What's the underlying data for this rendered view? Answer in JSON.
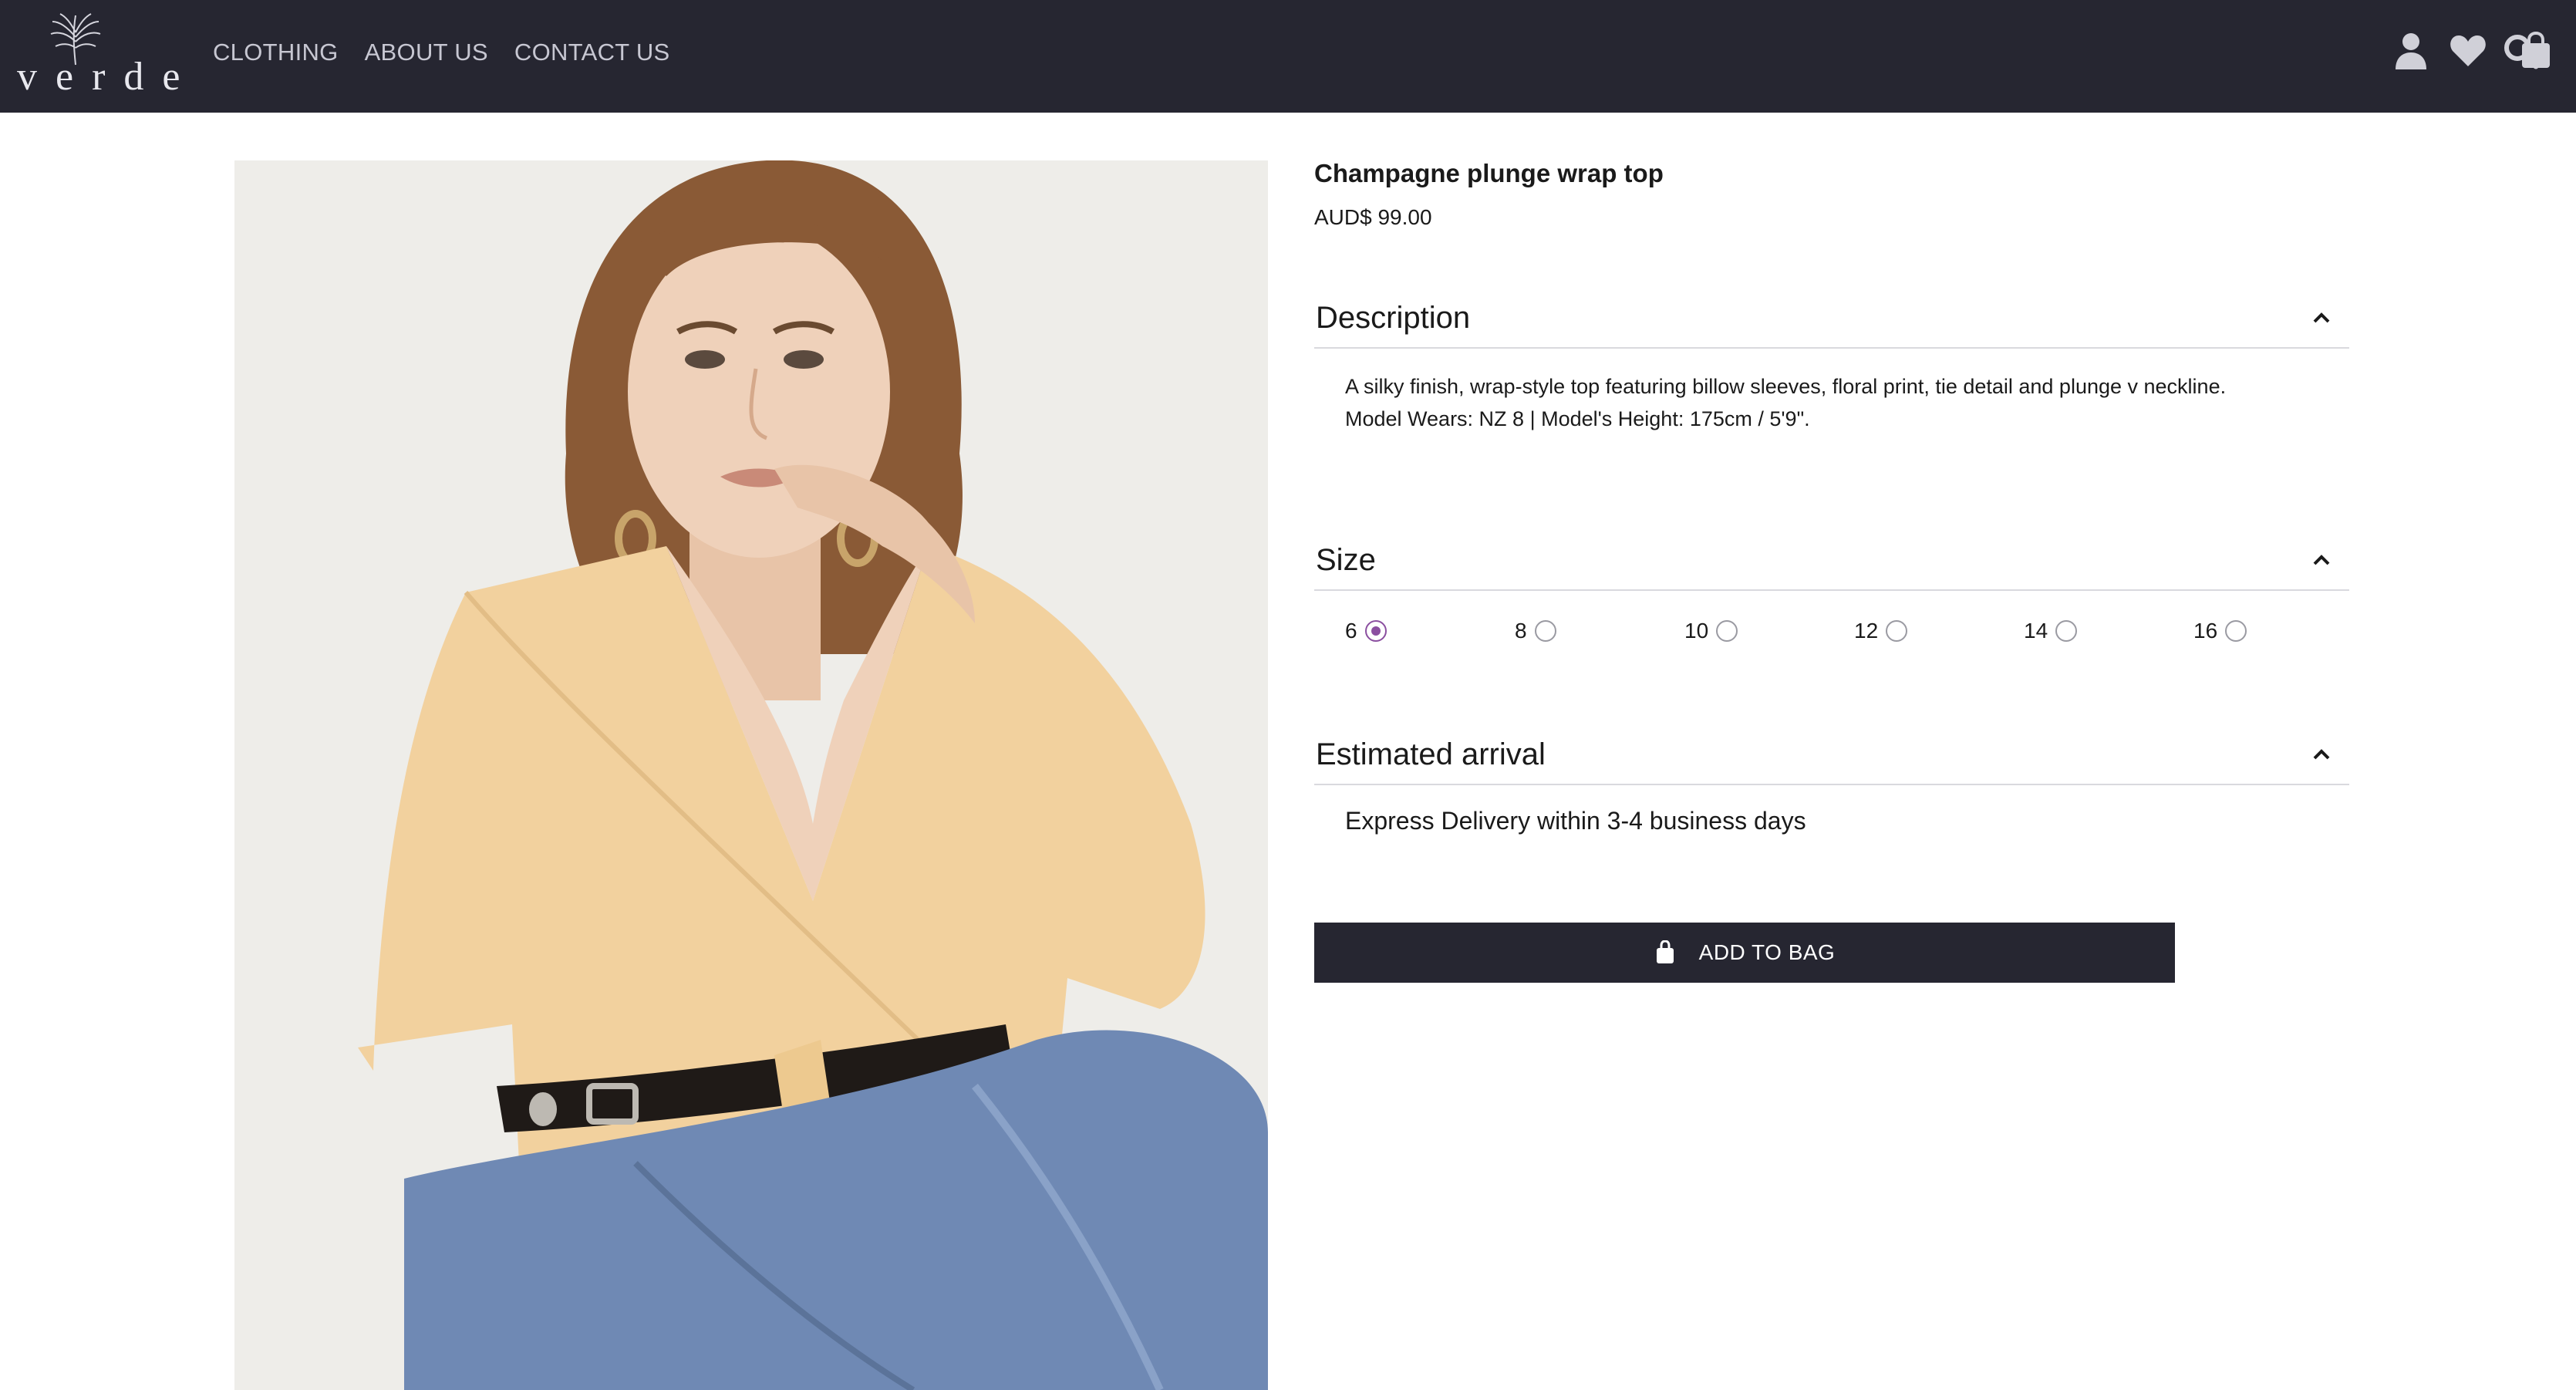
{
  "header": {
    "logo_text": "verde",
    "nav": [
      "CLOTHING",
      "ABOUT US",
      "CONTACT US"
    ],
    "icons": [
      "search-icon",
      "user-icon",
      "heart-icon",
      "bag-icon"
    ]
  },
  "product": {
    "title": "Champagne plunge wrap top",
    "price": "AUD$ 99.00",
    "description": {
      "heading": "Description",
      "line1": "A silky finish, wrap-style top featuring billow sleeves, floral print, tie detail and plunge v neckline.",
      "line2": "Model Wears: NZ 8 | Model's Height: 175cm / 5'9\"."
    },
    "size": {
      "heading": "Size",
      "options": [
        "6",
        "8",
        "10",
        "12",
        "14",
        "16"
      ],
      "selected": "6"
    },
    "arrival": {
      "heading": "Estimated arrival",
      "text": "Express Delivery within 3-4 business days"
    },
    "add_to_bag": "ADD TO BAG"
  },
  "colors": {
    "header_bg": "#262631",
    "accent_radio": "#8b4fa0",
    "button_bg": "#262631"
  }
}
